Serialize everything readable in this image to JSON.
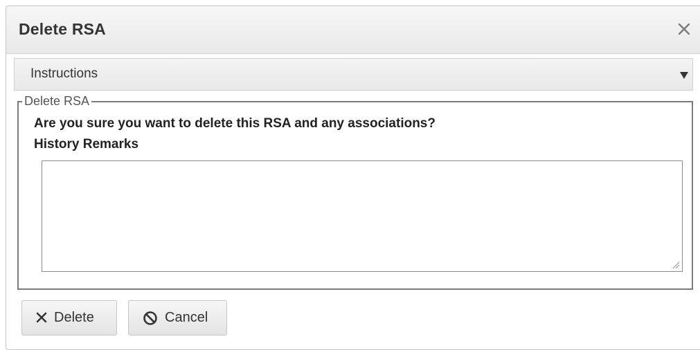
{
  "dialog": {
    "title": "Delete RSA",
    "close_icon": "close-icon"
  },
  "accordion": {
    "label": "Instructions",
    "arrow_icon": "caret-down-icon"
  },
  "fieldset": {
    "legend": "Delete RSA",
    "question": "Are you sure you want to delete this RSA and any associations?",
    "remarks_label": "History Remarks",
    "remarks_value": "",
    "remarks_placeholder": ""
  },
  "buttons": {
    "delete_label": "Delete",
    "delete_icon": "x-icon",
    "cancel_label": "Cancel",
    "cancel_icon": "cancel-circle-icon"
  },
  "colors": {
    "title_text": "#333333",
    "border": "#7a7a7a",
    "header_bg": "#e9e9e9"
  }
}
